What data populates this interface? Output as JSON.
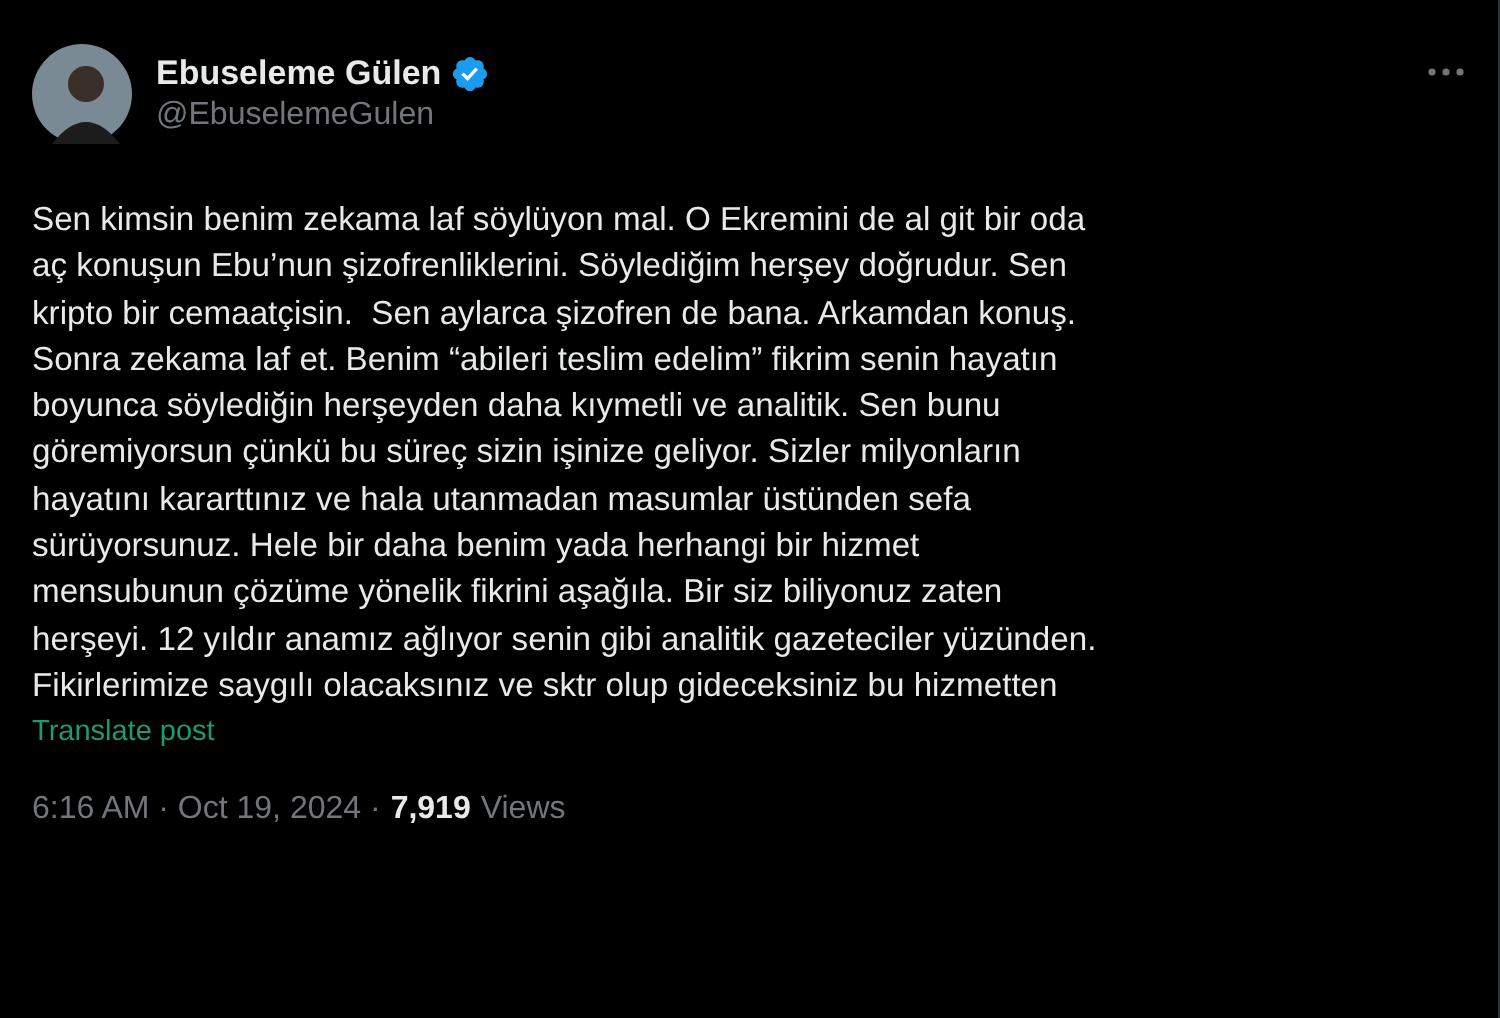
{
  "author": {
    "name": "Ebuseleme Gülen",
    "handle": "@EbuselemeGulen",
    "verified": true
  },
  "body_lines": [
    "Sen kimsin benim zekama laf söylüyon mal. O Ekremini de al git bir oda",
    "aç konuşun Ebu’nun şizofrenliklerini. Söylediğim herşey doğrudur. Sen",
    "kripto bir cemaatçisin.  Sen aylarca şizofren de bana. Arkamdan konuş.",
    "Sonra zekama laf et. Benim “abileri teslim edelim” fikrim senin hayatın",
    "boyunca söylediğin herşeyden daha kıymetli ve analitik. Sen bunu",
    "göremiyorsun çünkü bu süreç sizin işinize geliyor. Sizler milyonların",
    "hayatını kararttınız ve hala utanmadan masumlar üstünden sefa",
    "sürüyorsunuz. Hele bir daha benim yada herhangi bir hizmet",
    "mensubunun çözüme yönelik fikrini aşağıla. Bir siz biliyonuz zaten",
    "herşeyi. 12 yıldır anamız ağlıyor senin gibi analitik gazeteciler yüzünden.",
    "Fikirlerimize saygılı olacaksınız ve sktr olup gideceksiniz bu hizmetten"
  ],
  "translate_link": "Translate post",
  "meta": {
    "timestamp": "6:16 AM · Oct 19, 2024 ·",
    "views": "7,919",
    "views_label": "Views"
  }
}
